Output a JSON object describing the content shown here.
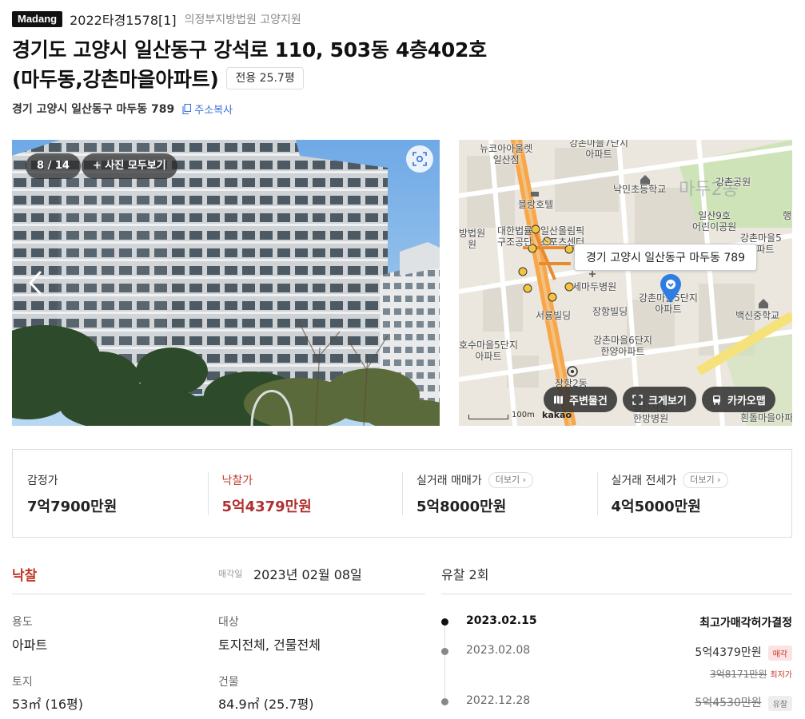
{
  "header": {
    "brand": "Madang",
    "case_no": "2022타경1578[1]",
    "court": "의정부지방법원 고양지원",
    "address_line1": "경기도 고양시 일산동구 강석로 110, 503동 4층402호",
    "address_line2": "(마두동,강촌마을아파트)",
    "area_badge": "전용 25.7평",
    "jibun_address": "경기 고양시 일산동구 마두동 789",
    "copy_label": "주소복사"
  },
  "photo": {
    "counter": "8 / 14",
    "view_all": "+ 사진 모두보기"
  },
  "map": {
    "callout": "경기 고양시 일산동구 마두동 789",
    "labels": {
      "l1": "뉴코아아울렛\n일산점",
      "l2": "강촌마을7단지\n아파트",
      "l3": "낙민초등학교",
      "l4": "강촌공원",
      "l5": "마두2동",
      "l6": "블랑호텔",
      "l7": "일산9호\n어린이공원",
      "l8": "행",
      "l9": "방법원\n원",
      "l10": "대한법률\n구조공단",
      "l11": "일산올림픽\n스포츠센터",
      "l12": "강촌마을5\n아파트",
      "l13": "세마두병원",
      "l14": "강촌마을5단지\n아파트",
      "l15": "장항빌딩",
      "l16": "서룡빌딩",
      "l17": "백신중학교",
      "l18": "호수마을5단지\n아파트",
      "l19": "강촌마을6단지\n한양아파트",
      "l20": "장항2동",
      "l21": "일산자생\n한방병원",
      "l22": "흰돌마을아파"
    },
    "buttons": {
      "nearby": "주변물건",
      "expand": "크게보기",
      "kakaomap": "카카오맵"
    },
    "scale": "100m",
    "provider": "kakao"
  },
  "prices": [
    {
      "label": "감정가",
      "value": "7억7900만원",
      "highlight": false,
      "more": ""
    },
    {
      "label": "낙찰가",
      "value": "5억4379만원",
      "highlight": true,
      "more": ""
    },
    {
      "label": "실거래 매매가",
      "value": "5억8000만원",
      "highlight": false,
      "more": "더보기"
    },
    {
      "label": "실거래 전세가",
      "value": "4억5000만원",
      "highlight": false,
      "more": "더보기"
    }
  ],
  "status": {
    "result": "낙찰",
    "sale_date_label": "매각일",
    "sale_date": "2023년 02월 08일",
    "fields": {
      "use_label": "용도",
      "use_value": "아파트",
      "target_label": "대상",
      "target_value": "토지전체, 건물전체",
      "land_label": "토지",
      "land_value": "53㎡ (16평)",
      "building_label": "건물",
      "building_value": "84.9㎡ (25.7평)"
    }
  },
  "history": {
    "title": "유찰 2회",
    "entries": [
      {
        "date": "2023.02.15",
        "result": "최고가매각허가결정",
        "current": true
      },
      {
        "date": "2023.02.08",
        "price": "5억4379만원",
        "tag": "매각",
        "min_price": "3억8171만원",
        "min_label": "최저가"
      },
      {
        "date": "2022.12.28",
        "price": "5억4530만원",
        "tag": "유찰"
      }
    ]
  },
  "colors": {
    "accent_red": "#c0392b",
    "map_road": "#f7a64a",
    "pin_blue": "#2f7de1"
  }
}
